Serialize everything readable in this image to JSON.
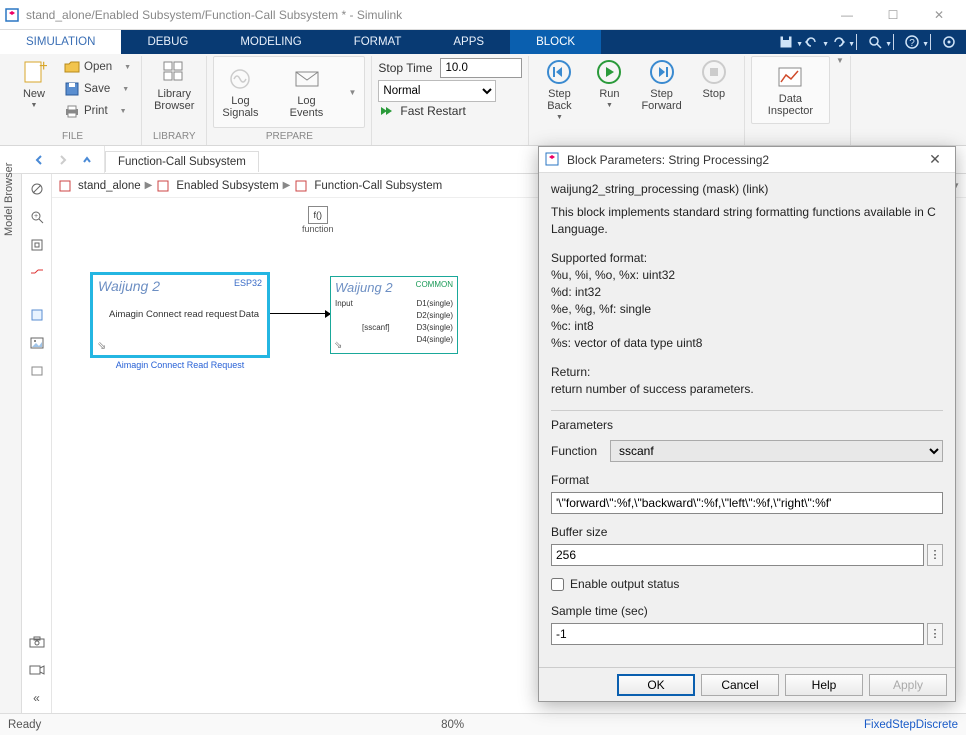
{
  "window": {
    "title": "stand_alone/Enabled Subsystem/Function-Call Subsystem * - Simulink",
    "min": "—",
    "max": "☐",
    "close": "✕"
  },
  "tabs": {
    "simulation": "SIMULATION",
    "debug": "DEBUG",
    "modeling": "MODELING",
    "format": "FORMAT",
    "apps": "APPS",
    "block": "BLOCK"
  },
  "toolstrip": {
    "file": {
      "new": "New",
      "open": "Open",
      "save": "Save",
      "print": "Print",
      "label": "FILE"
    },
    "library": {
      "browser": "Library\nBrowser",
      "label": "LIBRARY"
    },
    "prepare": {
      "log_signals": "Log\nSignals",
      "log_events": "Log\nEvents",
      "label": "PREPARE"
    },
    "sim": {
      "stoptime_label": "Stop Time",
      "stoptime_value": "10.0",
      "mode": "Normal",
      "fast_restart": "Fast Restart",
      "step_back": "Step\nBack",
      "run": "Run",
      "step_forward": "Step\nForward",
      "stop": "Stop"
    },
    "inspector": {
      "label": "Data\nInspector"
    }
  },
  "doctab": "Function-Call Subsystem",
  "breadcrumb": {
    "a": "stand_alone",
    "b": "Enabled Subsystem",
    "c": "Function-Call Subsystem"
  },
  "sidebar": {
    "model_browser": "Model Browser"
  },
  "canvas": {
    "fn_block": {
      "icon": "f()",
      "label": "function"
    },
    "block1": {
      "title": "Waijung 2",
      "tag": "ESP32",
      "text": "Aimagin Connect read request",
      "port": "Data",
      "caption": "Aimagin Connect Read Request",
      "link": "⇘"
    },
    "block2": {
      "title": "Waijung 2",
      "tag": "COMMON",
      "input": "Input",
      "fn": "[sscanf]",
      "ports": [
        "D1(single)",
        "D2(single)",
        "D3(single)",
        "D4(single)"
      ],
      "link": "⇘"
    }
  },
  "dialog": {
    "title": "Block Parameters: String Processing2",
    "subtitle": "waijung2_string_processing (mask) (link)",
    "desc": "This block implements standard string formatting functions available in C Language.",
    "fmt_hdr": "Supported format:",
    "fmt1": "%u, %i, %o, %x: uint32",
    "fmt2": "%d: int32",
    "fmt3": "%e, %g, %f: single",
    "fmt4": "%c: int8",
    "fmt5": "%s: vector of data type uint8",
    "ret_hdr": "Return:",
    "ret": "return number of success parameters.",
    "params_hdr": "Parameters",
    "function_label": "Function",
    "function_value": "sscanf",
    "format_label": "Format",
    "format_value": "'\\\"forward\\\":%f,\\\"backward\\\":%f,\\\"left\\\":%f,\\\"right\\\":%f'",
    "buffer_label": "Buffer size",
    "buffer_value": "256",
    "enable_output": "Enable output status",
    "sample_label": "Sample time (sec)",
    "sample_value": "-1",
    "ok": "OK",
    "cancel": "Cancel",
    "help": "Help",
    "apply": "Apply"
  },
  "status": {
    "ready": "Ready",
    "zoom": "80%",
    "solver": "FixedStepDiscrete"
  }
}
